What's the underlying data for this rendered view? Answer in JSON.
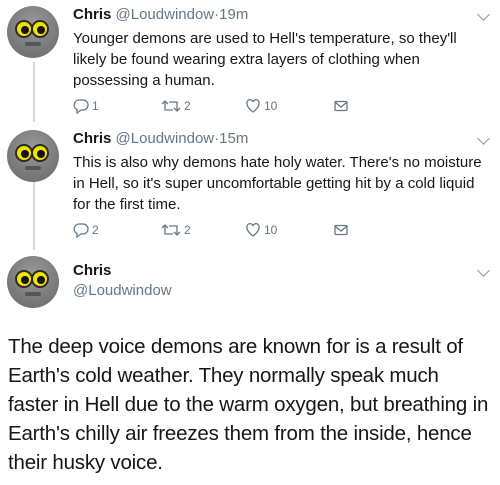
{
  "tweets": [
    {
      "name": "Chris",
      "handle": "@Loudwindow",
      "separator": "·",
      "time": "19m",
      "text": "Younger demons are used to Hell's temperature, so they'll likely be found wearing extra layers of clothing when possessing a human.",
      "reply_count": "1",
      "retweet_count": "2",
      "like_count": "10"
    },
    {
      "name": "Chris",
      "handle": "@Loudwindow",
      "separator": "·",
      "time": "15m",
      "text": "This is also why demons hate holy water. There's no moisture in Hell, so it's super uncomfortable getting hit by a cold liquid for the first time.",
      "reply_count": "2",
      "retweet_count": "2",
      "like_count": "10"
    }
  ],
  "main_tweet": {
    "name": "Chris",
    "handle": "@Loudwindow",
    "text": "The deep voice demons are known for is a result of Earth's cold weather. They normally speak much faster in Hell due to the warm oxygen, but breathing in Earth's chilly air freezes them from the inside, hence their husky voice."
  },
  "icons": {
    "reply": "reply-icon",
    "retweet": "retweet-icon",
    "like": "heart-icon",
    "message": "envelope-icon",
    "more": "chevron-down-icon"
  },
  "colors": {
    "text": "#14171a",
    "secondary": "#657786",
    "thread_line": "#cfd9de",
    "avatar_eye": "#f2e200"
  }
}
